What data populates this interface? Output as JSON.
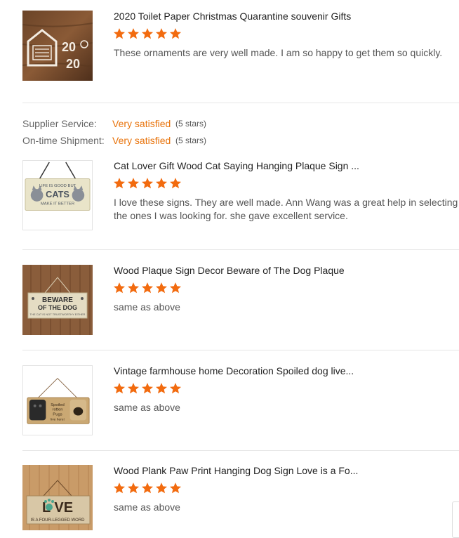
{
  "reviews": [
    {
      "title": "2020 Toilet Paper Christmas Quarantine souvenir Gifts",
      "rating": 5,
      "text": "These ornaments are very well made. I am so happy to get them so quickly.",
      "image": {
        "name": "ornament-2020-image",
        "caption_text": "2020"
      }
    },
    {
      "title": "Cat Lover Gift Wood Cat Saying Hanging Plaque Sign ...",
      "rating": 5,
      "text": "I love these signs. They are well made. Ann Wang was a great help in selecting the ones I was looking for. she gave excellent service.",
      "image": {
        "name": "cat-plaque-image",
        "caption_text": "LIFE IS GOOD BUT CATS MAKE IT BETTER"
      }
    },
    {
      "title": "Wood Plaque Sign Decor Beware of The Dog Plaque",
      "rating": 5,
      "text": "same as above",
      "image": {
        "name": "beware-dog-plaque-image",
        "caption_text": "BEWARE OF THE DOG"
      }
    },
    {
      "title": "Vintage farmhouse home Decoration Spoiled dog live...",
      "rating": 5,
      "text": "same as above",
      "image": {
        "name": "spoiled-pugs-plaque-image",
        "caption_text": "Spoiled rotten Pugs live here!"
      }
    },
    {
      "title": "Wood Plank Paw Print Hanging Dog Sign Love is a Fo...",
      "rating": 5,
      "text": "same as above",
      "image": {
        "name": "love-paw-plaque-image",
        "caption_text": "LOVE"
      }
    }
  ],
  "seller_ratings": [
    {
      "label": "Supplier Service:",
      "value": "Very satisfied",
      "count": "(5 stars)"
    },
    {
      "label": "On-time Shipment:",
      "value": "Very satisfied",
      "count": "(5 stars)"
    }
  ],
  "colors": {
    "star": "#f26b0f",
    "rating_value": "#e8730b",
    "divider": "#e6e6e6"
  },
  "icons": {
    "star": "star-icon"
  }
}
